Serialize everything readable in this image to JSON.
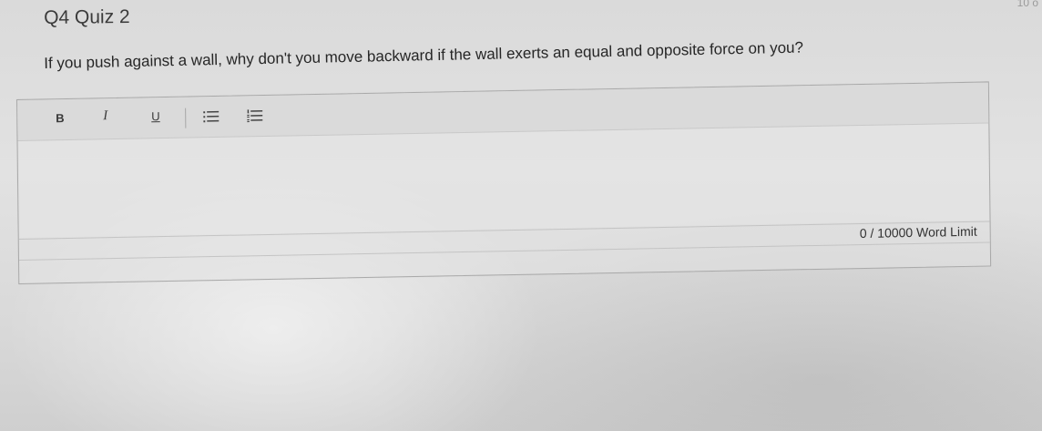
{
  "corner": {
    "text": "10 o"
  },
  "page": {
    "title": "Q4 Quiz 2"
  },
  "question": {
    "text": "If you push against a wall, why don't you move backward if the wall exerts an equal and opposite force on you?"
  },
  "editor": {
    "toolbar": {
      "bold_label": "B",
      "italic_label": "I",
      "underline_label": "U",
      "bullet_list_icon": "bullet-list-icon",
      "numbered_list_icon": "numbered-list-icon"
    },
    "answer_value": "",
    "word_count": {
      "current": "0",
      "limit": "10000",
      "label": "0 / 10000 Word Limit"
    }
  }
}
